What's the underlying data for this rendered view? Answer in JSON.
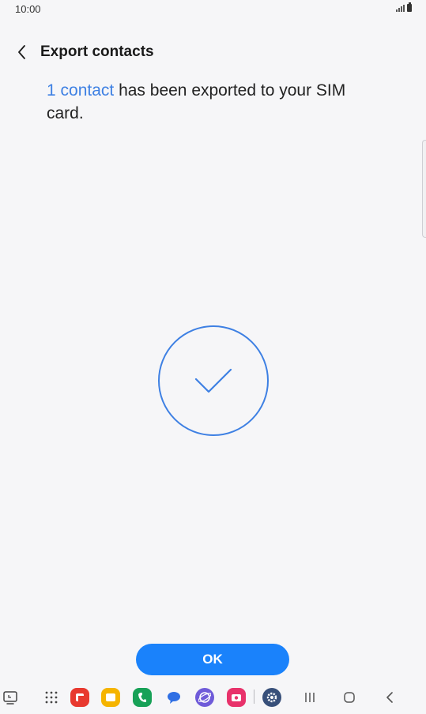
{
  "status_bar": {
    "time": "10:00"
  },
  "header": {
    "title": "Export contacts"
  },
  "message": {
    "link_text": "1 contact",
    "rest_text": " has been exported to your SIM card."
  },
  "actions": {
    "ok_label": "OK"
  },
  "colors": {
    "accent": "#3e80e3",
    "button": "#1a82fb",
    "background": "#f6f6f8"
  },
  "taskbar": {
    "apps": [
      {
        "name": "recent-screen-icon"
      },
      {
        "name": "app-grid-icon"
      },
      {
        "name": "flipboard-app-icon",
        "color": "#e8392f"
      },
      {
        "name": "my-files-app-icon",
        "color": "#f5b400"
      },
      {
        "name": "phone-app-icon",
        "color": "#17a157"
      },
      {
        "name": "messages-app-icon",
        "color": "#2f6fe4"
      },
      {
        "name": "internet-app-icon",
        "color": "#6f5bd9"
      },
      {
        "name": "camera-app-icon",
        "color": "#e8326b"
      },
      {
        "name": "settings-app-icon",
        "color": "#38507a"
      }
    ],
    "nav": [
      "recents-nav-icon",
      "home-nav-icon",
      "back-nav-icon"
    ]
  }
}
